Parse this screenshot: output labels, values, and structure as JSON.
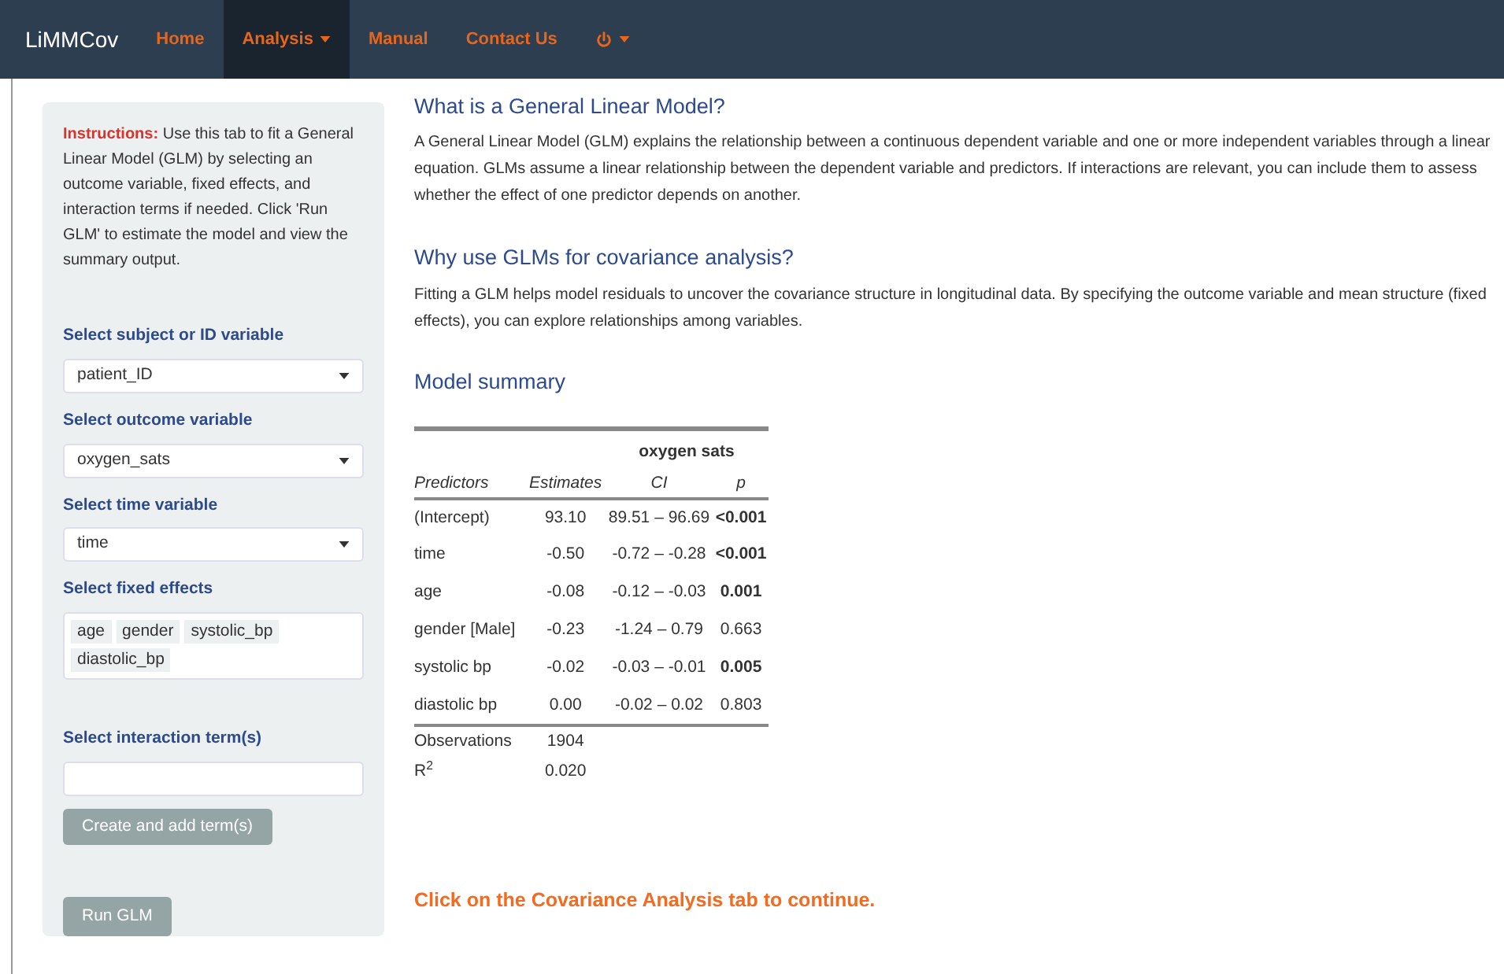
{
  "navbar": {
    "brand": "LiMMCov",
    "items": [
      {
        "label": "Home",
        "selected": false,
        "dropdown": false
      },
      {
        "label": "Analysis",
        "selected": true,
        "dropdown": true
      },
      {
        "label": "Manual",
        "selected": false,
        "dropdown": false
      },
      {
        "label": "Contact Us",
        "selected": false,
        "dropdown": false
      },
      {
        "kind": "power",
        "selected": false,
        "dropdown": true
      }
    ]
  },
  "sidebar": {
    "instructions_label": "Instructions:",
    "instructions": "Use this tab to fit a General Linear Model (GLM) by selecting an outcome variable, fixed effects, and interaction terms if needed. Click 'Run GLM' to estimate the model and view the summary output.",
    "controls": [
      {
        "kind": "select",
        "label": "Select subject or ID variable",
        "value": "patient_ID"
      },
      {
        "kind": "select",
        "label": "Select outcome variable",
        "value": "oxygen_sats"
      },
      {
        "kind": "select",
        "label": "Select time variable",
        "value": "time"
      },
      {
        "kind": "multi",
        "label": "Select fixed effects",
        "tags": [
          "age",
          "gender",
          "systolic_bp",
          "diastolic_bp"
        ]
      },
      {
        "kind": "text",
        "label": "Select interaction term(s)"
      }
    ],
    "add_button": "Create and add term(s)",
    "run_button": "Run GLM"
  },
  "main": {
    "sections": [
      {
        "title": "What is a General Linear Model?",
        "text": "A General Linear Model (GLM) explains the relationship between a continuous dependent variable and one or more independent variables through a linear equation. GLMs assume a linear relationship between the dependent variable and predictors. If interactions are relevant, you can include them to assess whether the effect of one predictor depends on another."
      },
      {
        "title": "Why use GLMs for covariance analysis?",
        "text": "Fitting a GLM helps model residuals to uncover the covariance structure in longitudinal data. By specifying the outcome variable and mean structure (fixed effects), you can explore relationships among variables."
      }
    ],
    "summary_title": "Model summary",
    "table": {
      "outcome": "oxygen sats",
      "columns": [
        "Predictors",
        "Estimates",
        "CI",
        "p"
      ],
      "rows": [
        {
          "predictor": "(Intercept)",
          "estimate": "93.10",
          "ci": "89.51 – 96.69",
          "p": "<0.001",
          "significant": true
        },
        {
          "predictor": "time",
          "estimate": "-0.50",
          "ci": "-0.72 – -0.28",
          "p": "<0.001",
          "significant": true
        },
        {
          "predictor": "age",
          "estimate": "-0.08",
          "ci": "-0.12 – -0.03",
          "p": "0.001",
          "significant": true
        },
        {
          "predictor": "gender [Male]",
          "estimate": "-0.23",
          "ci": "-1.24 – 0.79",
          "p": "0.663",
          "significant": false
        },
        {
          "predictor": "systolic bp",
          "estimate": "-0.02",
          "ci": "-0.03 – -0.01",
          "p": "0.005",
          "significant": true
        },
        {
          "predictor": "diastolic bp",
          "estimate": "0.00",
          "ci": "-0.02 – 0.02",
          "p": "0.803",
          "significant": false
        }
      ],
      "footer": [
        {
          "label": "Observations",
          "value": "1904"
        },
        {
          "label": "R$^{2}$",
          "value": "0.020"
        }
      ]
    },
    "continue_note": "Click on the Covariance Analysis tab to continue."
  }
}
